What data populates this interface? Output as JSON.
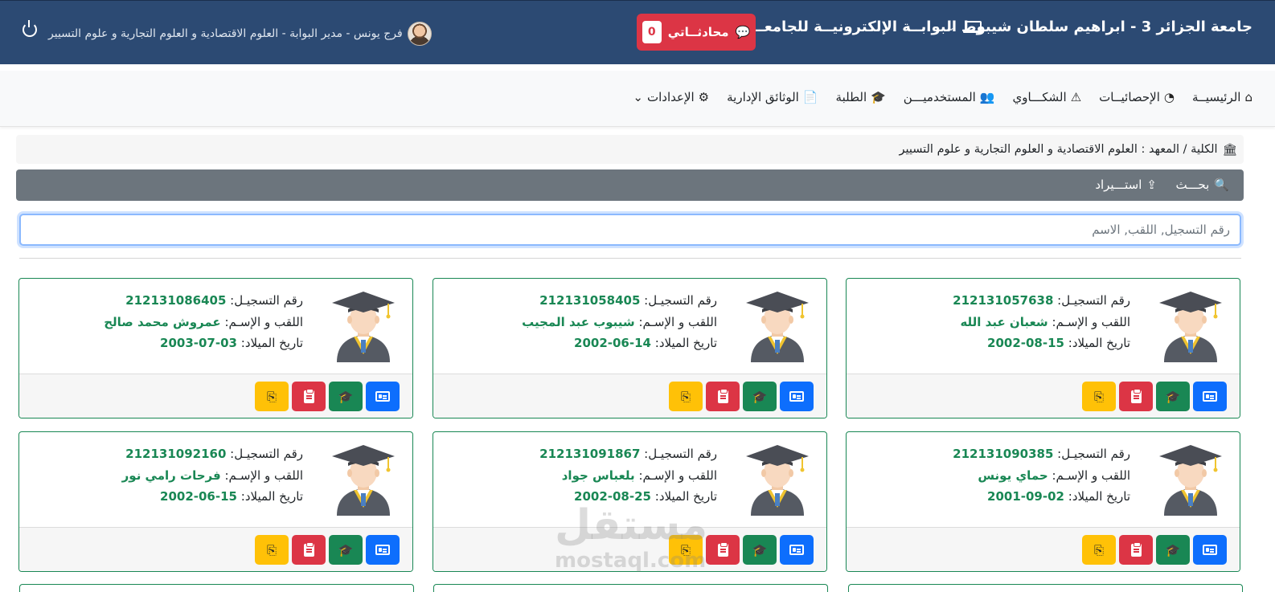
{
  "header": {
    "university": "جامعة الجزائر 3 - ابراهيم سلطان شيبوط",
    "portal": "البوابــة الإلكترونيــة للجامعــة",
    "chat_label": "محادثــاتي",
    "chat_count": "0",
    "user": "فرج يونس - مدير البوابة - العلوم الاقتصادية و العلوم التجارية و علوم التسيير"
  },
  "nav": [
    {
      "label": "الرئيسيــة",
      "icon": "home-icon"
    },
    {
      "label": "الإحصائيــات",
      "icon": "pie-chart-icon"
    },
    {
      "label": "الشكـــاوي",
      "icon": "warning-icon"
    },
    {
      "label": "المستخدميـــن",
      "icon": "users-icon"
    },
    {
      "label": "الطلبة",
      "icon": "graduate-icon"
    },
    {
      "label": "الوثائق الإدارية",
      "icon": "document-icon"
    },
    {
      "label": "الإعدادات",
      "icon": "gear-icon"
    }
  ],
  "breadcrumb": "الكلية / المعهد : العلوم الاقتصادية و العلوم التجارية و علوم التسيير",
  "toolbar": {
    "search": "بحـــث",
    "import": "استـــيراد"
  },
  "search": {
    "placeholder": "رقم التسجيل, اللقب, الاسم"
  },
  "labels": {
    "reg": "رقم التسجيـل:",
    "name": "اللقب و الإسـم:",
    "dob": "تاريخ الميلاد:"
  },
  "students": [
    {
      "reg": "212131057638",
      "name": "شعبان عبد الله",
      "dob": "15-08-2002"
    },
    {
      "reg": "212131058405",
      "name": "شيبوب عبد المجيب",
      "dob": "14-06-2002"
    },
    {
      "reg": "212131086405",
      "name": "عمروش محمد صالح",
      "dob": "03-07-2003"
    },
    {
      "reg": "212131090385",
      "name": "حماي يونس",
      "dob": "02-09-2001"
    },
    {
      "reg": "212131091867",
      "name": "بلعباس جواد",
      "dob": "25-08-2002"
    },
    {
      "reg": "212131092160",
      "name": "فرحات رامي نور",
      "dob": "15-06-2002"
    }
  ],
  "watermark": {
    "ar": "مستقل",
    "en": "mostaql.com"
  },
  "colors": {
    "header": "#2c4a73",
    "accent_green": "#198754",
    "blue": "#0d6efd",
    "red": "#dc3545",
    "yellow": "#ffc107",
    "toolbar": "#6c757d"
  }
}
